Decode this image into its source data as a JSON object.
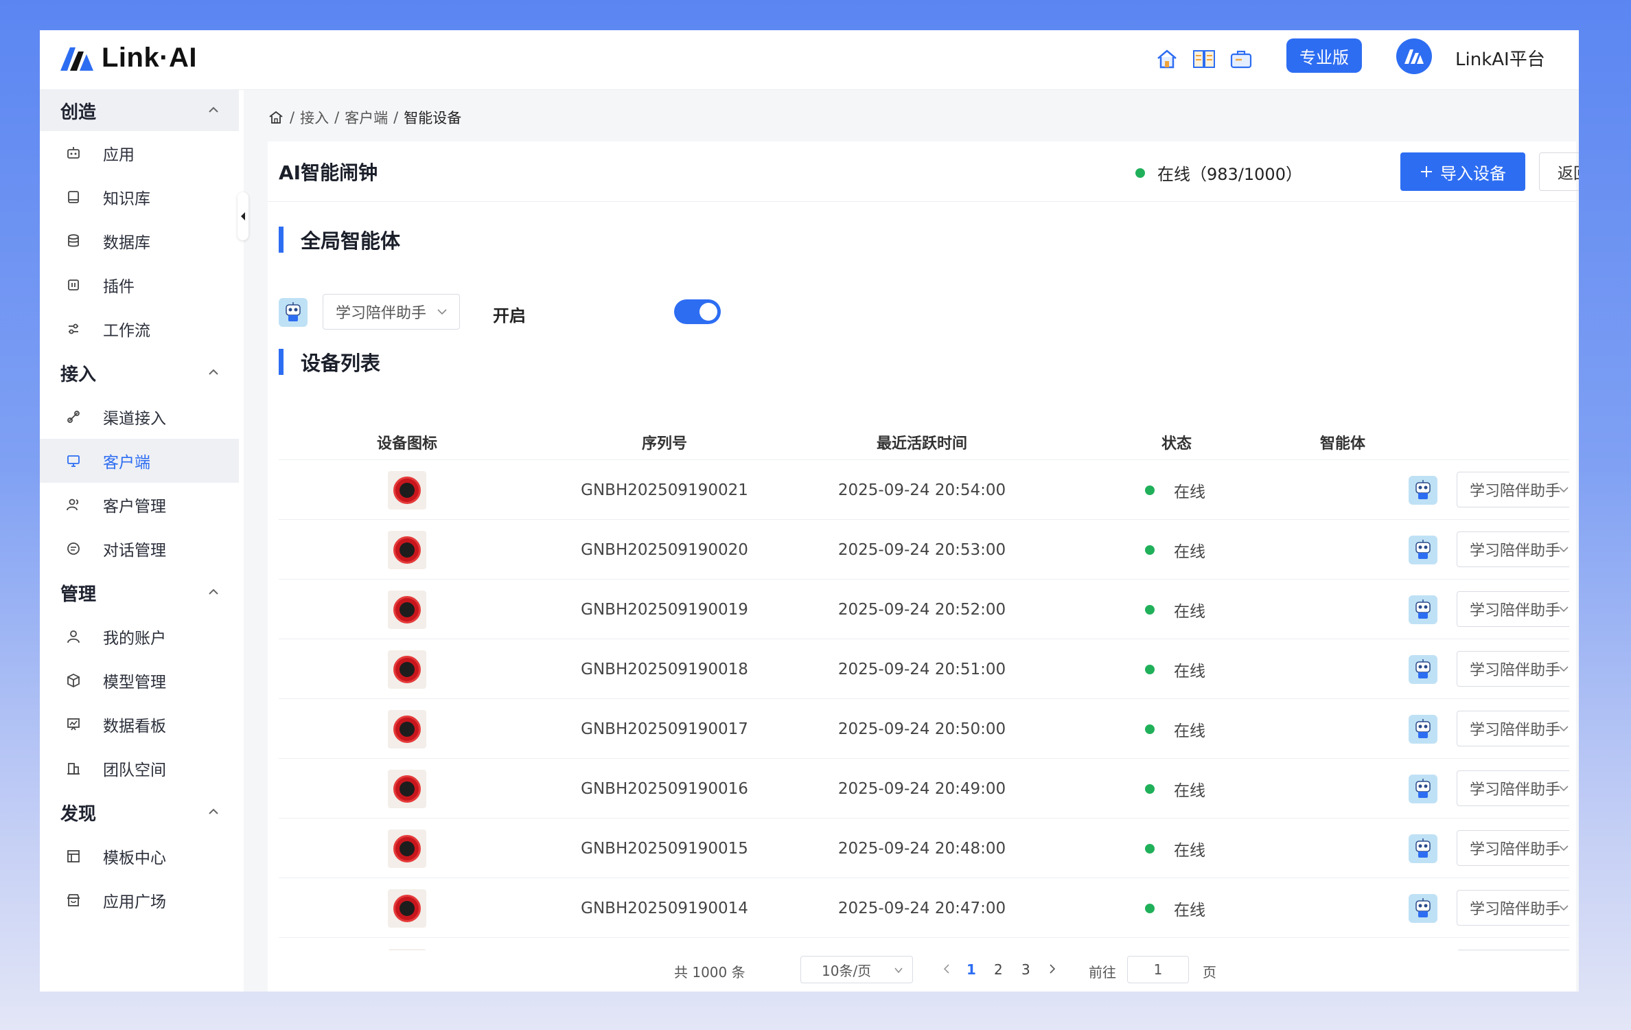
{
  "app": {
    "logo_text": "Link·AI",
    "pro_label": "专业版",
    "platform_name": "LinkAI平台"
  },
  "sidebar": {
    "sections": [
      {
        "title": "创造",
        "items": [
          "应用",
          "知识库",
          "数据库",
          "插件",
          "工作流"
        ]
      },
      {
        "title": "接入",
        "items": [
          "渠道接入",
          "客户端",
          "客户管理",
          "对话管理"
        ]
      },
      {
        "title": "管理",
        "items": [
          "我的账户",
          "模型管理",
          "数据看板",
          "团队空间"
        ]
      },
      {
        "title": "发现",
        "items": [
          "模板中心",
          "应用广场"
        ]
      }
    ],
    "active_item": "客户端"
  },
  "breadcrumb": {
    "items": [
      "接入",
      "客户端"
    ],
    "current": "智能设备"
  },
  "card": {
    "title": "AI智能闹钟",
    "online_label": "在线",
    "online_count": "（983/1000）",
    "import_label": "导入设备",
    "back_label": "返回"
  },
  "global_agent": {
    "section_title": "全局智能体",
    "selected_agent": "学习陪伴助手",
    "toggle_label": "开启",
    "toggle_on": true
  },
  "device_list": {
    "section_title": "设备列表",
    "columns": [
      "设备图标",
      "序列号",
      "最近活跃时间",
      "状态",
      "智能体"
    ],
    "rows": [
      {
        "serial": "GNBH202509190021",
        "last_active": "2025-09-24 20:54:00",
        "status": "在线",
        "agent": "学习陪伴助手"
      },
      {
        "serial": "GNBH202509190020",
        "last_active": "2025-09-24 20:53:00",
        "status": "在线",
        "agent": "学习陪伴助手"
      },
      {
        "serial": "GNBH202509190019",
        "last_active": "2025-09-24 20:52:00",
        "status": "在线",
        "agent": "学习陪伴助手"
      },
      {
        "serial": "GNBH202509190018",
        "last_active": "2025-09-24 20:51:00",
        "status": "在线",
        "agent": "学习陪伴助手"
      },
      {
        "serial": "GNBH202509190017",
        "last_active": "2025-09-24 20:50:00",
        "status": "在线",
        "agent": "学习陪伴助手"
      },
      {
        "serial": "GNBH202509190016",
        "last_active": "2025-09-24 20:49:00",
        "status": "在线",
        "agent": "学习陪伴助手"
      },
      {
        "serial": "GNBH202509190015",
        "last_active": "2025-09-24 20:48:00",
        "status": "在线",
        "agent": "学习陪伴助手"
      },
      {
        "serial": "GNBH202509190014",
        "last_active": "2025-09-24 20:47:00",
        "status": "在线",
        "agent": "学习陪伴助手"
      }
    ]
  },
  "pagination": {
    "total_label": "共 1000 条",
    "page_size": "10条/页",
    "pages": [
      "1",
      "2",
      "3"
    ],
    "current_page": "1",
    "goto_label": "前往",
    "goto_value": "1",
    "page_suffix": "页"
  },
  "colors": {
    "primary": "#2d6df2",
    "online": "#20b05a"
  }
}
